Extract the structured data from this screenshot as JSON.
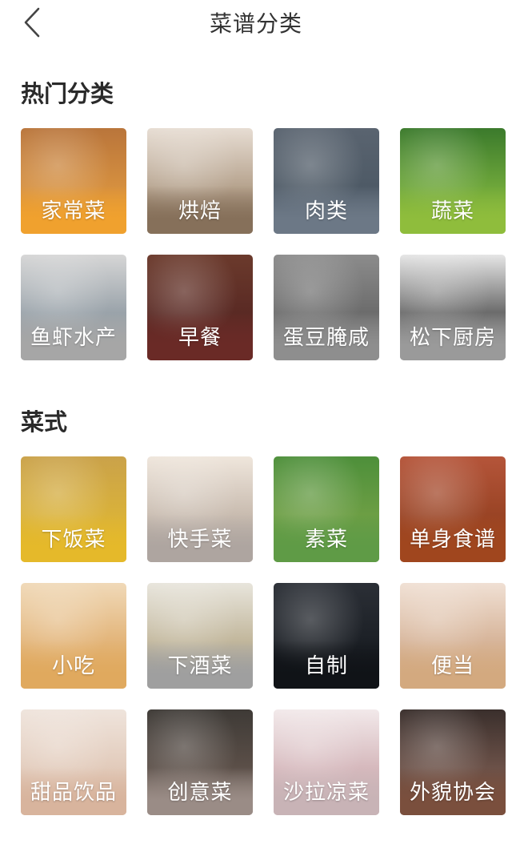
{
  "header": {
    "title": "菜谱分类"
  },
  "sections": [
    {
      "title": "热门分类",
      "items": [
        {
          "label": "家常菜",
          "name": "category-home-dishes",
          "top": "#b9753b",
          "mid": "#d58f3f",
          "band": "#f0a12e"
        },
        {
          "label": "烘焙",
          "name": "category-baking",
          "top": "#e7ddd3",
          "mid": "#b7a48f",
          "band": "#86705a"
        },
        {
          "label": "肉类",
          "name": "category-meat",
          "top": "#5a6470",
          "mid": "#4e5a66",
          "band": "#6c7886"
        },
        {
          "label": "蔬菜",
          "name": "category-vegetables",
          "top": "#3b7a2c",
          "mid": "#6da63a",
          "band": "#8fbd3c"
        },
        {
          "label": "鱼虾水产",
          "name": "category-seafood",
          "top": "#d6d6d6",
          "mid": "#9aa3aa",
          "band": "#a6a6a6"
        },
        {
          "label": "早餐",
          "name": "category-breakfast",
          "top": "#6b3a2c",
          "mid": "#5a2a24",
          "band": "#6a2a26"
        },
        {
          "label": "蛋豆腌咸",
          "name": "category-eggs-beans-pickled",
          "top": "#8c8c8c",
          "mid": "#6c6c6c",
          "band": "#8e8e8e"
        },
        {
          "label": "松下厨房",
          "name": "category-panasonic-kitchen",
          "top": "#e6e6e6",
          "mid": "#6b6b6b",
          "band": "#9a9a9a"
        }
      ]
    },
    {
      "title": "菜式",
      "items": [
        {
          "label": "下饭菜",
          "name": "category-rice-dishes",
          "top": "#caa24a",
          "mid": "#d9b13a",
          "band": "#e5b92a"
        },
        {
          "label": "快手菜",
          "name": "category-quick-dishes",
          "top": "#efe6dc",
          "mid": "#c9bcb0",
          "band": "#aea5a0"
        },
        {
          "label": "素菜",
          "name": "category-vegetarian",
          "top": "#4d8f3a",
          "mid": "#6c9e44",
          "band": "#5f9b46"
        },
        {
          "label": "单身食谱",
          "name": "category-single-recipes",
          "top": "#b5553a",
          "mid": "#9a4425",
          "band": "#a0461e"
        },
        {
          "label": "小吃",
          "name": "category-snacks",
          "top": "#f0d9b8",
          "mid": "#e3b57a",
          "band": "#e0a95e"
        },
        {
          "label": "下酒菜",
          "name": "category-bar-snacks",
          "top": "#e8e5dc",
          "mid": "#c2b79c",
          "band": "#9f9f9f"
        },
        {
          "label": "自制",
          "name": "category-homemade",
          "top": "#2b2f36",
          "mid": "#1c2026",
          "band": "#101317"
        },
        {
          "label": "便当",
          "name": "category-bento",
          "top": "#f0e0d4",
          "mid": "#d7b59a",
          "band": "#d3a97f"
        },
        {
          "label": "甜品饮品",
          "name": "category-desserts-drinks",
          "top": "#efe4dc",
          "mid": "#e2cbbb",
          "band": "#d8b49d"
        },
        {
          "label": "创意菜",
          "name": "category-creative-dishes",
          "top": "#3e3a36",
          "mid": "#5b4f48",
          "band": "#9a8c86"
        },
        {
          "label": "沙拉凉菜",
          "name": "category-salads-cold-dishes",
          "top": "#f2e9ea",
          "mid": "#d6b9bd",
          "band": "#c8b3b6"
        },
        {
          "label": "外貌协会",
          "name": "category-pretty-dishes",
          "top": "#3a2f2c",
          "mid": "#6b5148",
          "band": "#7a4f3d"
        }
      ]
    }
  ]
}
